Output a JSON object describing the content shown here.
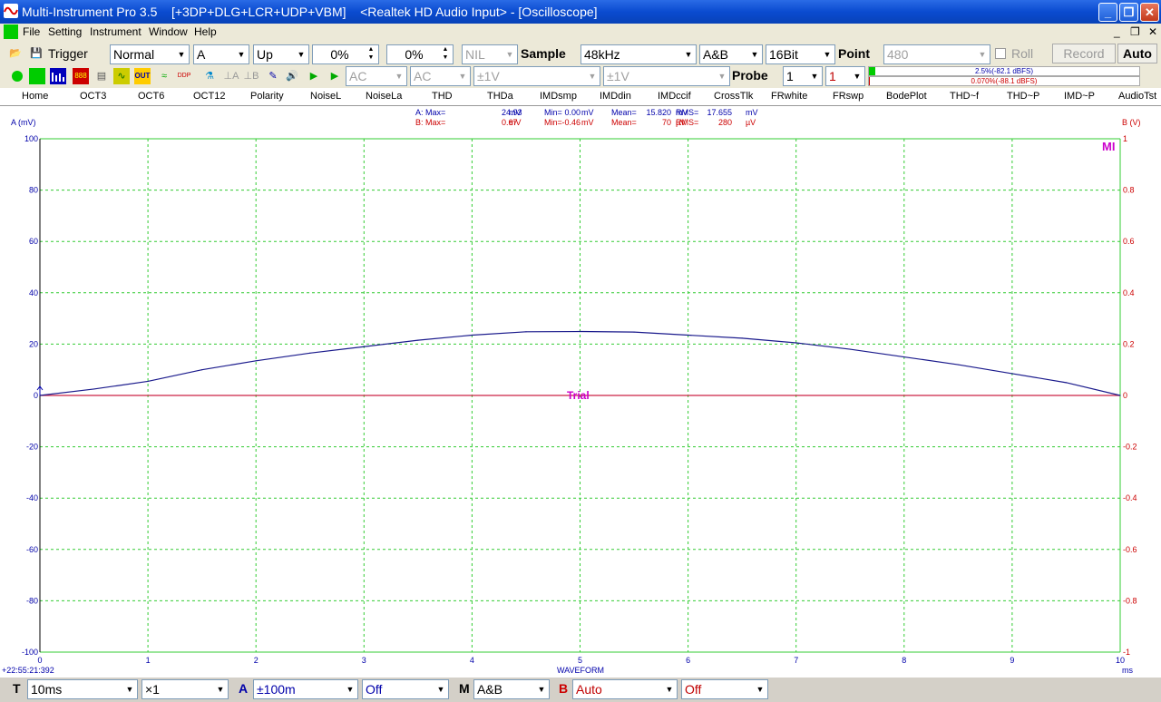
{
  "window": {
    "title": "Multi-Instrument Pro 3.5    [+3DP+DLG+LCR+UDP+VBM]    <Realtek HD Audio Input> - [Oscilloscope]"
  },
  "menu": {
    "items": [
      "File",
      "Setting",
      "Instrument",
      "Window",
      "Help"
    ]
  },
  "toolbar1": {
    "trigger_label": "Trigger",
    "trigger_mode": "Normal",
    "trigger_channel": "A",
    "trigger_edge": "Up",
    "trigger_level": "0%",
    "trigger_delay": "0%",
    "nil": "NIL",
    "sample_label": "Sample",
    "sample_rate": "48kHz",
    "channels": "A&B",
    "bits": "16Bit",
    "point_label": "Point",
    "points": "480",
    "roll_label": "Roll",
    "record_label": "Record",
    "auto_label": "Auto"
  },
  "toolbar2": {
    "coupling_a": "AC",
    "coupling_b": "AC",
    "range_a": "±1V",
    "range_b": "±1V",
    "probe_label": "Probe",
    "probe_a": "1",
    "probe_b": "1",
    "meter_a": "2.5%(-82.1 dBFS)",
    "meter_b": "0.070%(-88.1 dBFS)",
    "meter_a_level": 0.025,
    "meter_b_level": 0.0007
  },
  "tabs": [
    "Home",
    "OCT3",
    "OCT6",
    "OCT12",
    "Polarity",
    "NoiseL",
    "NoiseLa",
    "THD",
    "THDa",
    "IMDsmp",
    "IMDdin",
    "IMDccif",
    "CrossTlk",
    "FRwhite",
    "FRswp",
    "BodePlot",
    "THD~f",
    "THD~P",
    "IMD~P",
    "AudioTst"
  ],
  "stats": {
    "a_row": [
      "A: Max=",
      "24.93",
      "mV",
      "Min=",
      "0.00",
      "mV",
      "Mean=",
      "15.820",
      "mV",
      "RMS=",
      "17.655",
      "mV"
    ],
    "b_row": [
      "B: Max=",
      "0.67",
      "mV",
      "Min=",
      "-0.46",
      "mV",
      "Mean=",
      "70",
      "µV",
      "RMS=",
      "280",
      "µV"
    ]
  },
  "plot": {
    "y_left_label": "A (mV)",
    "y_right_label": "B (V)",
    "x_title": "WAVEFORM",
    "x_unit": "ms",
    "timestamp": "+22:55:21:392",
    "trial_text": "Trial",
    "watermark": "MI",
    "y_left_ticks": [
      "100",
      "80",
      "60",
      "40",
      "20",
      "0",
      "-20",
      "-40",
      "-60",
      "-80",
      "-100"
    ],
    "y_right_ticks": [
      "1",
      "0.8",
      "0.6",
      "0.4",
      "0.2",
      "0",
      "-0.2",
      "-0.4",
      "-0.6",
      "-0.8",
      "-1"
    ],
    "x_ticks": [
      "0",
      "1",
      "2",
      "3",
      "4",
      "5",
      "6",
      "7",
      "8",
      "9",
      "10"
    ],
    "colors": {
      "grid": "#33cc33",
      "channel_a": "#1a1a8c",
      "channel_b": "#cc2244",
      "trial": "#cc00cc"
    }
  },
  "chart_data": {
    "type": "line",
    "xlabel": "WAVEFORM",
    "x_unit": "ms",
    "xlim": [
      0,
      10
    ],
    "ylim_left": [
      -100,
      100
    ],
    "ylim_right": [
      -1,
      1
    ],
    "series": [
      {
        "name": "A",
        "unit": "mV",
        "x": [
          0,
          0.5,
          1,
          1.5,
          2,
          2.5,
          3,
          3.5,
          4,
          4.5,
          5,
          5.5,
          6,
          6.5,
          7,
          7.5,
          8,
          8.5,
          9,
          9.5,
          10
        ],
        "y": [
          0,
          2.5,
          5.5,
          10,
          13.5,
          16.5,
          19,
          21.5,
          23.5,
          24.8,
          24.9,
          24.7,
          23.5,
          22.3,
          20.5,
          18,
          15,
          12,
          8.5,
          5,
          0
        ]
      },
      {
        "name": "B",
        "unit": "V",
        "x": [
          0,
          10
        ],
        "y": [
          0,
          0
        ]
      }
    ]
  },
  "statusbar": {
    "t_label": "T",
    "timebase": "10ms",
    "zoom": "×1",
    "a_label": "A",
    "a_range": "±100m",
    "a_mode": "Off",
    "m_label": "M",
    "m_mode": "A&B",
    "b_label": "B",
    "b_range": "Auto",
    "b_mode": "Off"
  }
}
